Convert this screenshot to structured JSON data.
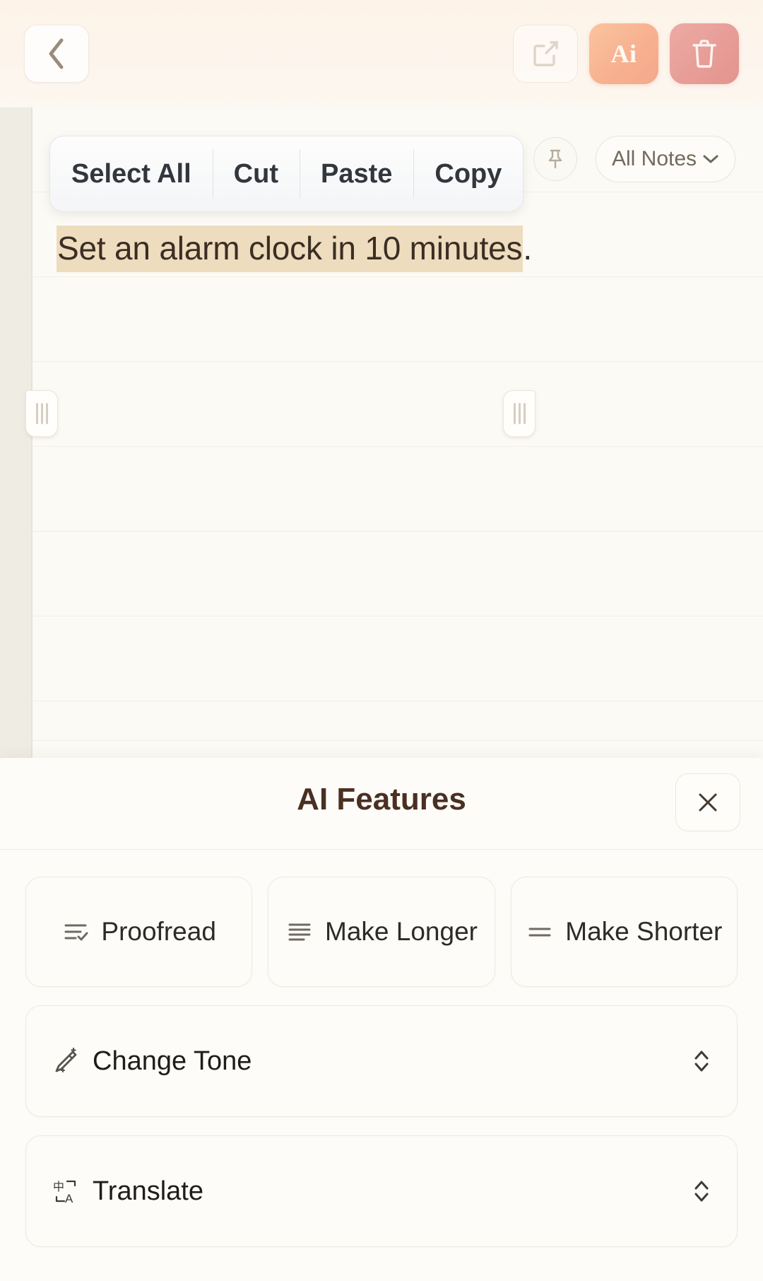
{
  "topbar": {
    "back_icon": "chevron-left-icon",
    "share_icon": "share-external-icon",
    "ai_label": "Ai",
    "delete_icon": "trash-icon"
  },
  "context_menu": {
    "items": [
      {
        "label": "Select All"
      },
      {
        "label": "Cut"
      },
      {
        "label": "Paste"
      },
      {
        "label": "Copy"
      }
    ]
  },
  "note_toolbar": {
    "pin_icon": "pin-icon",
    "folder_label": "All Notes",
    "folder_caret_icon": "chevron-down-icon"
  },
  "note": {
    "selected_text": "Set an alarm clock in 10 minutes",
    "trailing_text": ".",
    "selection_highlight_color": "#eedcbe",
    "text_color": "#3a2e24"
  },
  "ai_panel": {
    "title": "AI Features",
    "close_icon": "close-icon",
    "quick_actions": [
      {
        "label": "Proofread",
        "icon": "list-check-icon"
      },
      {
        "label": "Make Longer",
        "icon": "list-lines-icon"
      },
      {
        "label": "Make Shorter",
        "icon": "two-lines-icon"
      }
    ],
    "expandable_rows": [
      {
        "label": "Change Tone",
        "icon": "magic-wand-icon",
        "chevron_icon": "chevron-updown-icon"
      },
      {
        "label": "Translate",
        "icon": "translate-icon",
        "chevron_icon": "chevron-updown-icon"
      }
    ]
  }
}
